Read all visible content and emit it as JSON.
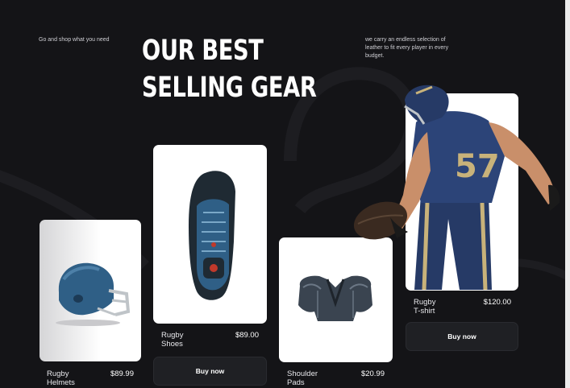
{
  "hero": {
    "tagline_left": "Go and shop what you need",
    "headline_line1": "OUR BEST",
    "headline_line2": "SELLING GEAR",
    "tagline_right": "we carry an endless selection of leather to fit every player in every budget."
  },
  "products": [
    {
      "name_line1": "Rugby",
      "name_line2": "Helmets",
      "price": "$89.99",
      "image_icon": "football-helmet-icon"
    },
    {
      "name_line1": "Rugby",
      "name_line2": "Shoes",
      "price": "$89.00",
      "button": "Buy now",
      "image_icon": "cleat-shoe-icon"
    },
    {
      "name_line1": "Shoulder",
      "name_line2": "Pads",
      "price": "$20.99",
      "image_icon": "shoulder-pads-icon"
    },
    {
      "name_line1": "Rugby",
      "name_line2": "T-shirt",
      "price": "$120.00",
      "button": "Buy now",
      "image_icon": "player-photo"
    }
  ],
  "colors": {
    "background": "#141417",
    "card": "#ffffff",
    "button": "#1f2024",
    "text": "#ffffff",
    "accent_blue": "#2f5f86",
    "accent_gold": "#c8b27a"
  }
}
